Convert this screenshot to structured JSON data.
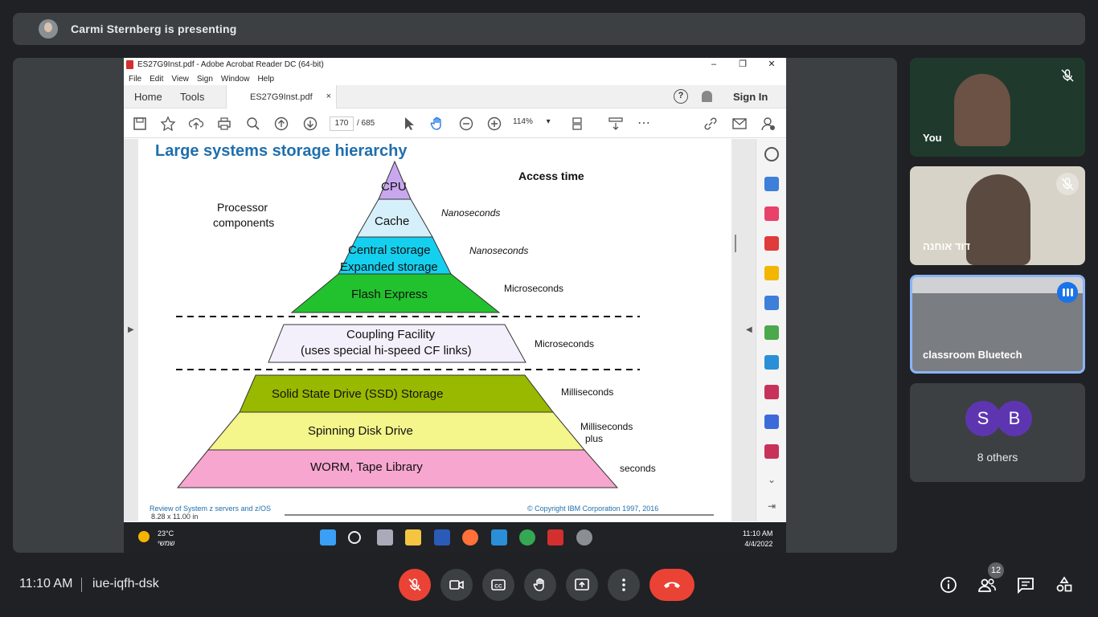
{
  "banner": {
    "text": "Carmi Sternberg is presenting"
  },
  "acrobat": {
    "title": "ES27G9Inst.pdf - Adobe Acrobat Reader DC (64-bit)",
    "menu": [
      "File",
      "Edit",
      "View",
      "Sign",
      "Window",
      "Help"
    ],
    "tabs": {
      "home": "Home",
      "tools": "Tools",
      "doc": "ES27G9Inst.pdf",
      "close": "×"
    },
    "help": "?",
    "sign_in": "Sign In",
    "page_current": "170",
    "page_total": "/ 685",
    "zoom": "114%",
    "page_size": "8.28 x 11.00 in"
  },
  "slide": {
    "title": "Large systems storage hierarchy",
    "access_time": "Access time",
    "processor_components": [
      "Processor",
      "components"
    ],
    "levels": {
      "cpu": "CPU",
      "cache": "Cache",
      "central": "Central storage",
      "expanded": "Expanded storage",
      "flash": "Flash Express",
      "coupling1": "Coupling Facility",
      "coupling2": "(uses special hi-speed CF links)",
      "ssd": "Solid State Drive (SSD) Storage",
      "spinning": "Spinning Disk Drive",
      "worm": "WORM, Tape Library"
    },
    "times": {
      "cache": "Nanoseconds",
      "central": "Nanoseconds",
      "flash": "Microseconds",
      "coupling": "Microseconds",
      "ssd": "Milliseconds",
      "spinning1": "Milliseconds",
      "spinning2": "plus",
      "worm": "seconds"
    },
    "footer_left": "Review of System z servers and z/OS",
    "footer_right": "© Copyright IBM Corporation 1997, 2016"
  },
  "taskbar": {
    "temp": "23°C",
    "weather": "שמשי",
    "time": "11:10 AM",
    "date": "4/4/2022"
  },
  "participants": [
    {
      "name": "You",
      "mic": "muted"
    },
    {
      "name": "דוד אוחנה",
      "mic": "muted"
    },
    {
      "name": "classroom Bluetech",
      "mic": "speaking"
    }
  ],
  "others": {
    "avatars": [
      "S",
      "B"
    ],
    "label": "8 others"
  },
  "bottom": {
    "time": "11:10 AM",
    "meeting_code": "iue-iqfh-dsk",
    "people_count": "12"
  },
  "colors": {
    "accent_red": "#ea4335",
    "bg": "#202124",
    "tile": "#3c4043",
    "speaking": "#1a73e8"
  }
}
